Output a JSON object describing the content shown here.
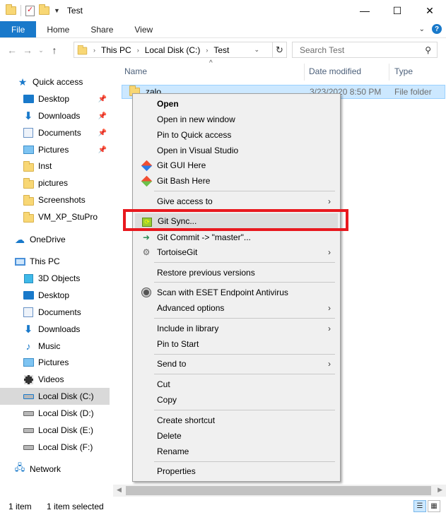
{
  "window": {
    "title": "Test",
    "minimize": "—",
    "maximize": "☐",
    "close": "✕"
  },
  "ribbon": {
    "tabs": [
      "File",
      "Home",
      "Share",
      "View"
    ]
  },
  "address": {
    "crumbs": [
      "This PC",
      "Local Disk (C:)",
      "Test"
    ],
    "search_placeholder": "Search Test"
  },
  "sidebar": {
    "quick_access": "Quick access",
    "quick_items": [
      {
        "label": "Desktop",
        "icon": "desktop-icon",
        "pinned": true
      },
      {
        "label": "Downloads",
        "icon": "downloads-icon",
        "pinned": true
      },
      {
        "label": "Documents",
        "icon": "documents-icon",
        "pinned": true
      },
      {
        "label": "Pictures",
        "icon": "pictures-icon",
        "pinned": true
      },
      {
        "label": "Inst",
        "icon": "folder-icon",
        "pinned": false
      },
      {
        "label": "pictures",
        "icon": "folder-icon",
        "pinned": false
      },
      {
        "label": "Screenshots",
        "icon": "folder-icon",
        "pinned": false
      },
      {
        "label": "VM_XP_StuPro",
        "icon": "folder-icon",
        "pinned": false
      }
    ],
    "onedrive": "OneDrive",
    "this_pc": "This PC",
    "pc_items": [
      {
        "label": "3D Objects",
        "icon": "3d-objects-icon"
      },
      {
        "label": "Desktop",
        "icon": "desktop-icon"
      },
      {
        "label": "Documents",
        "icon": "documents-icon"
      },
      {
        "label": "Downloads",
        "icon": "downloads-icon"
      },
      {
        "label": "Music",
        "icon": "music-icon"
      },
      {
        "label": "Pictures",
        "icon": "pictures-icon"
      },
      {
        "label": "Videos",
        "icon": "videos-icon"
      },
      {
        "label": "Local Disk (C:)",
        "icon": "drive-icon",
        "selected": true
      },
      {
        "label": "Local Disk (D:)",
        "icon": "drive-icon"
      },
      {
        "label": "Local Disk (E:)",
        "icon": "drive-icon"
      },
      {
        "label": "Local Disk (F:)",
        "icon": "drive-icon"
      }
    ],
    "network": "Network"
  },
  "content": {
    "columns": {
      "name": "Name",
      "date": "Date modified",
      "type": "Type"
    },
    "row": {
      "name": "zalo",
      "date": "3/23/2020 8:50 PM",
      "type": "File folder"
    }
  },
  "context_menu": {
    "open": "Open",
    "open_new_window": "Open in new window",
    "pin_quick": "Pin to Quick access",
    "open_vs": "Open in Visual Studio",
    "git_gui": "Git GUI Here",
    "git_bash": "Git Bash Here",
    "give_access": "Give access to",
    "git_sync": "Git Sync...",
    "git_commit": "Git Commit -> \"master\"...",
    "tortoisegit": "TortoiseGit",
    "restore": "Restore previous versions",
    "scan": "Scan with ESET Endpoint Antivirus",
    "advanced": "Advanced options",
    "include_library": "Include in library",
    "pin_start": "Pin to Start",
    "send_to": "Send to",
    "cut": "Cut",
    "copy": "Copy",
    "create_shortcut": "Create shortcut",
    "delete": "Delete",
    "rename": "Rename",
    "properties": "Properties"
  },
  "status": {
    "items": "1 item",
    "selected": "1 item selected"
  },
  "colors": {
    "accent": "#1979ca",
    "highlight": "#e8181e",
    "selection": "#cce8ff"
  }
}
